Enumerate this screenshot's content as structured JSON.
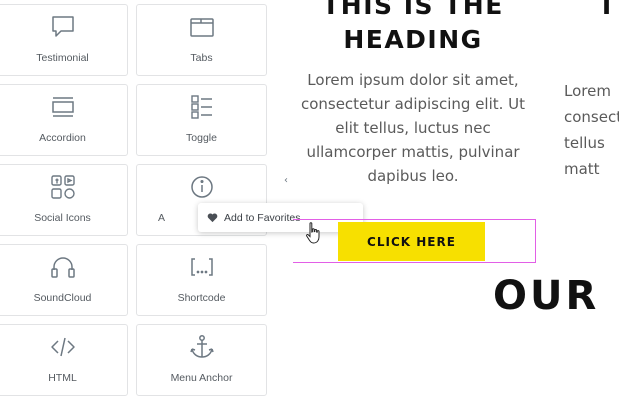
{
  "widgets": [
    {
      "label": "Testimonial",
      "icon": "testimonial-icon"
    },
    {
      "label": "Tabs",
      "icon": "tabs-icon"
    },
    {
      "label": "Accordion",
      "icon": "accordion-icon"
    },
    {
      "label": "Toggle",
      "icon": "toggle-icon"
    },
    {
      "label": "Social Icons",
      "icon": "social-icons-icon"
    },
    {
      "label": "A",
      "icon": "alert-icon"
    },
    {
      "label": "SoundCloud",
      "icon": "soundcloud-icon"
    },
    {
      "label": "Shortcode",
      "icon": "shortcode-icon"
    },
    {
      "label": "HTML",
      "icon": "html-icon"
    },
    {
      "label": "Menu Anchor",
      "icon": "menu-anchor-icon"
    }
  ],
  "collapse_glyph": "‹",
  "context_menu": {
    "label": "Add to Favorites",
    "icon": "heart-icon"
  },
  "canvas": {
    "heading_line1": "THIS IS THE",
    "heading_line2": "HEADING",
    "body_lines": [
      "Lorem ipsum dolor sit amet,",
      "consectetur adipiscing elit. Ut",
      "elit tellus, luctus nec",
      "ullamcorper mattis, pulvinar",
      "dapibus leo."
    ],
    "button_label": "CLICK HERE",
    "next_heading": "OUR",
    "right_heading": "T",
    "right_lines": [
      "Lorem",
      "consect",
      "tellus",
      "matt"
    ]
  },
  "colors": {
    "button_bg": "#f7e000",
    "selection_outline": "#e25fe6",
    "icon_stroke": "#6d7882"
  }
}
